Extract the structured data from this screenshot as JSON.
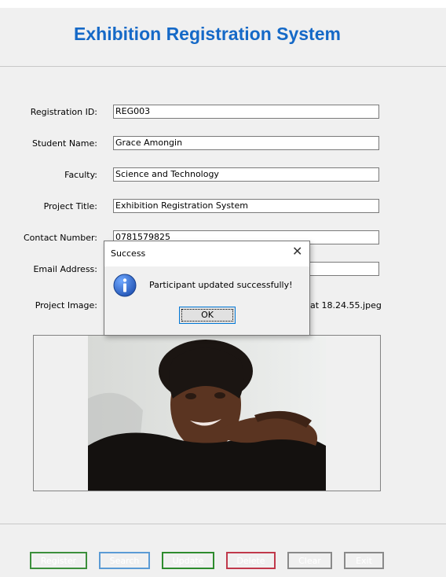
{
  "app": {
    "title": "Exhibition Registration System"
  },
  "form": {
    "registration_id": {
      "label": "Registration ID:",
      "value": "REG003"
    },
    "student_name": {
      "label": "Student Name:",
      "value": "Grace Amongin"
    },
    "faculty": {
      "label": "Faculty:",
      "value": "Science and Technology"
    },
    "project_title": {
      "label": "Project Title:",
      "value": "Exhibition Registration System"
    },
    "contact_number": {
      "label": "Contact Number:",
      "value": "0781579825"
    },
    "email_address": {
      "label": "Email Address:",
      "value": ""
    },
    "project_image": {
      "label": "Project Image:",
      "filename_visible": "at 18.24.55.jpeg"
    }
  },
  "buttons": {
    "register": "Register",
    "search": "Search",
    "update": "Update",
    "delete": "Delete",
    "clear": "Clear",
    "exit": "Exit"
  },
  "button_colors": {
    "register": "#3c8f3c",
    "search": "#5b9bd5",
    "update": "#2e8b2e",
    "delete": "#c0394b",
    "clear": "#8a8a8a",
    "exit": "#8a8a8a"
  },
  "dialog": {
    "title": "Success",
    "message": "Participant updated successfully!",
    "ok_label": "OK",
    "icon": "info-icon",
    "close_icon": "close-icon"
  },
  "colors": {
    "title": "#1569c7",
    "window_bg": "#f0f0f0",
    "dialog_accent": "#0078d7"
  }
}
